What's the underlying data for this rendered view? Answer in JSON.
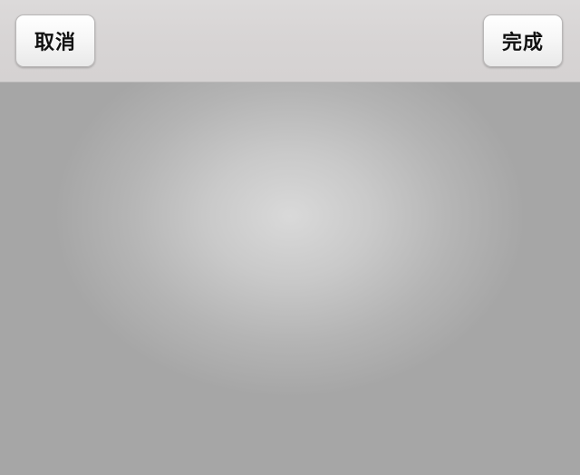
{
  "toolbar": {
    "cancel_label": "取消",
    "done_label": "完成"
  },
  "colors": {
    "toolbar_bg": "#d7d4d4",
    "canvas_center": "#d9d9d9",
    "canvas_edge": "#a6a6a6"
  }
}
